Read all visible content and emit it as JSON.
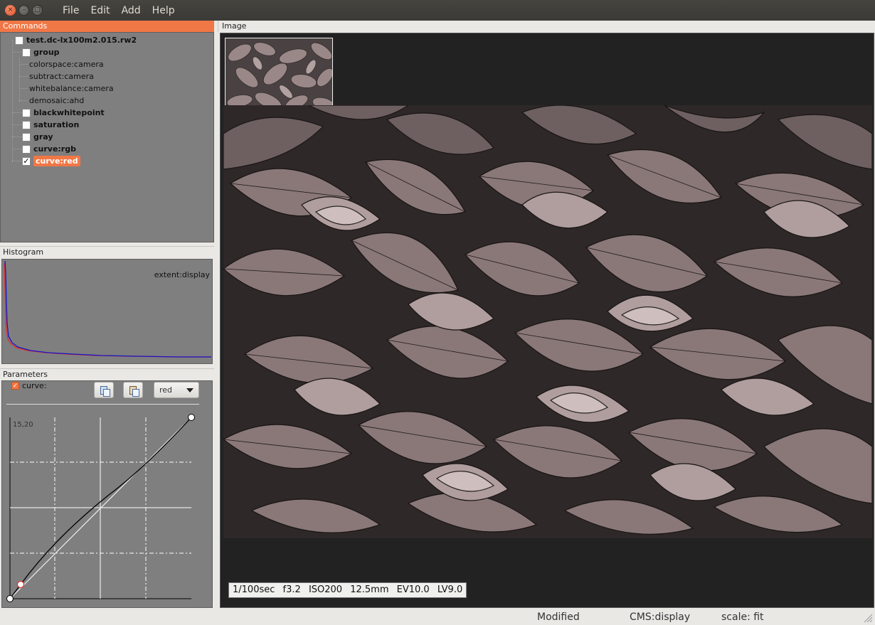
{
  "window": {
    "buttons": {
      "close": "×",
      "minimize": "–",
      "maximize": "□"
    }
  },
  "menu": [
    "File",
    "Edit",
    "Add",
    "Help"
  ],
  "commands": {
    "title": "Commands",
    "file": "test.dc-lx100m2.015.rw2",
    "group_label": "group",
    "group_items": [
      "colorspace:camera",
      "subtract:camera",
      "whitebalance:camera",
      "demosaic:ahd"
    ],
    "items": [
      {
        "label": "blackwhitepoint",
        "checked": false
      },
      {
        "label": "saturation",
        "checked": false
      },
      {
        "label": "gray",
        "checked": false
      },
      {
        "label": "curve:rgb",
        "checked": false
      },
      {
        "label": "curve:red",
        "checked": true
      }
    ],
    "checkmark": "✓"
  },
  "histogram": {
    "title": "Histogram",
    "extent": "extent:display",
    "series_colors": {
      "red": "#e03030",
      "blue": "#1515c8"
    }
  },
  "parameters": {
    "title": "Parameters",
    "curve_label": "curve:",
    "curve_checked": true,
    "channel": "red",
    "coord": "15,20",
    "checkmark": "✓"
  },
  "image": {
    "title": "Image",
    "exif": {
      "shutter": "1/100sec",
      "aperture": "f3.2",
      "iso": "ISO200",
      "focal": "12.5mm",
      "ev": "EV10.0",
      "lv": "LV9.0"
    }
  },
  "status": {
    "modified": "Modified",
    "cms": "CMS:display",
    "scale": "scale: fit"
  },
  "colors": {
    "accent": "#f07746",
    "panel_bg": "#7f7f7f",
    "image_bg": "#222222"
  }
}
